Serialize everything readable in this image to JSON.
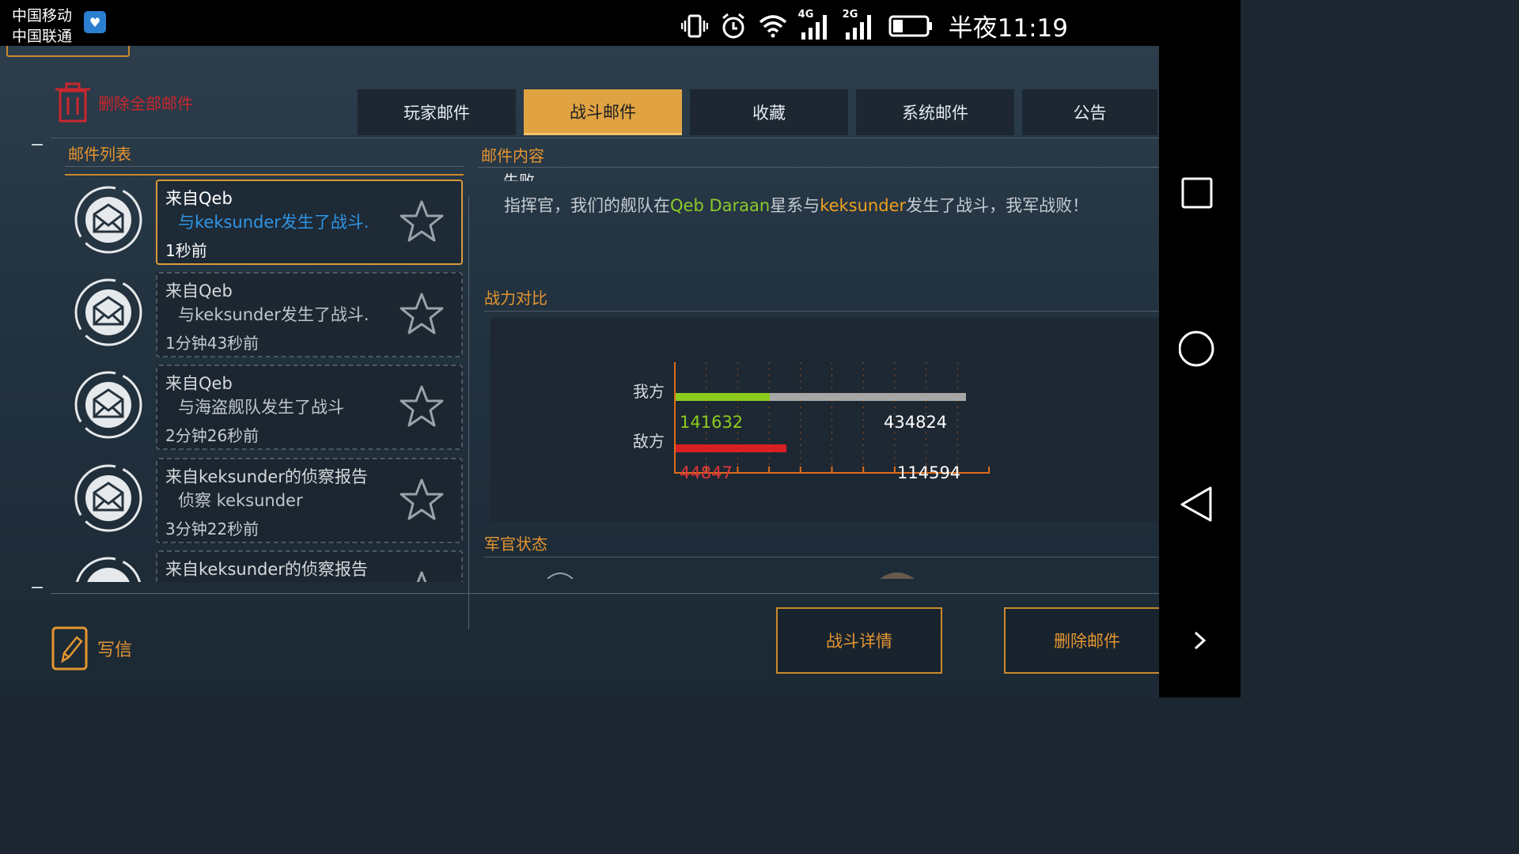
{
  "status_bar": {
    "carrier_1": "中国移动",
    "carrier_2": "中国联通",
    "network_1": "4G",
    "network_2": "2G",
    "time": "半夜11:19"
  },
  "toolbar": {
    "delete_all_label": "删除全部邮件"
  },
  "tabs": [
    {
      "label": "玩家邮件",
      "active": false
    },
    {
      "label": "战斗邮件",
      "active": true
    },
    {
      "label": "收藏",
      "active": false
    },
    {
      "label": "系统邮件",
      "active": false
    },
    {
      "label": "公告",
      "active": false
    }
  ],
  "mail_list": {
    "title": "邮件列表",
    "items": [
      {
        "from": "来自Qeb",
        "subject": "与keksunder发生了战斗.",
        "time": "1秒前",
        "selected": true
      },
      {
        "from": "来自Qeb",
        "subject": "与keksunder发生了战斗.",
        "time": "1分钟43秒前",
        "selected": false
      },
      {
        "from": "来自Qeb",
        "subject": "与海盗舰队发生了战斗",
        "time": "2分钟26秒前",
        "selected": false
      },
      {
        "from": "来自keksunder的侦察报告",
        "subject": "侦察 keksunder",
        "time": "3分钟22秒前",
        "selected": false
      },
      {
        "from": "来自keksunder的侦察报告",
        "subject": "",
        "time": "",
        "selected": false
      }
    ]
  },
  "content": {
    "title": "邮件内容",
    "partial_header": "失败",
    "body_prefix": "指挥官，我们的舰队在",
    "body_location": "Qeb Daraan",
    "body_mid": "星系与",
    "body_enemy": "keksunder",
    "body_suffix": "发生了战斗，我军战败！"
  },
  "power_compare": {
    "title": "战力对比",
    "ours_label": "我方",
    "enemy_label": "敌方",
    "ours_current": "141632",
    "ours_total": "434824",
    "enemy_current": "44847",
    "enemy_total": "114594",
    "ours_fraction": 0.326,
    "enemy_fraction": 0.391
  },
  "officer_status": {
    "title": "军官状态"
  },
  "actions": {
    "write_label": "写信",
    "battle_detail_label": "战斗详情",
    "delete_mail_label": "删除邮件"
  },
  "colors": {
    "accent": "#e49530",
    "tab_active": "#e1a342",
    "ours_bar": "#8ccc1f",
    "enemy_bar": "#d81f24",
    "total_bar": "#a7a7a7",
    "danger": "#c9272d"
  }
}
